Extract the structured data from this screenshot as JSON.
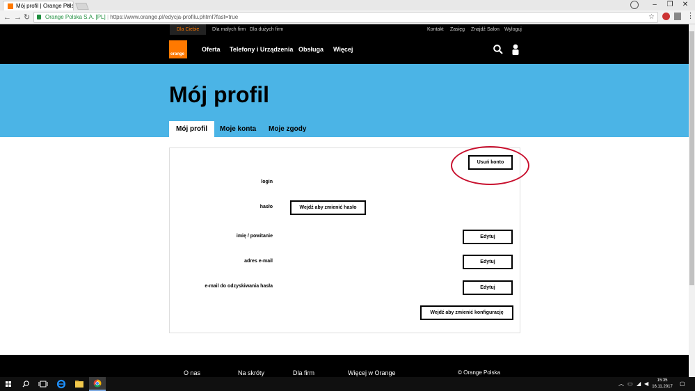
{
  "browser": {
    "tab_title": "Mój profil | Orange Polsk",
    "tab_close": "✕",
    "window_controls": [
      "–",
      "❐",
      "✕"
    ],
    "back": "←",
    "forward": "→",
    "reload": "↻",
    "site_identity": "Orange Polska S.A. [PL]",
    "separator": "|",
    "url": "https://www.orange.pl/edycja-profilu.phtml?fast=true",
    "bookmark_star": "☆",
    "menu": "⋮"
  },
  "topbar": {
    "segments": [
      "Dla Ciebie",
      "Dla małych firm",
      "Dla dużych firm"
    ],
    "utility": [
      "Kontakt",
      "Zasięg",
      "Znajdź Salon",
      "Wyloguj"
    ]
  },
  "nav": {
    "logo_text": "orange",
    "links": [
      "Oferta",
      "Telefony i Urządzenia",
      "Obsługa",
      "Więcej"
    ]
  },
  "hero": {
    "title": "Mój profil",
    "tabs": [
      "Mój profil",
      "Moje konta",
      "Moje zgody"
    ]
  },
  "profile": {
    "delete_account": "Usuń konto",
    "login_label": "login",
    "password_label": "hasło",
    "change_password": "Wejdź aby zmienić hasło",
    "name_label": "imię / powitanie",
    "email_label": "adres e-mail",
    "recovery_label": "e-mail do odzyskiwania hasła",
    "edit": "Edytuj",
    "change_config": "Wejdź aby zmienić konfigurację"
  },
  "footer": {
    "links": [
      "O nas",
      "Na skróty",
      "Dla firm",
      "Więcej w Orange"
    ],
    "copyright": "© Orange Polska"
  },
  "taskbar": {
    "time": "15:35",
    "date": "16.11.2017"
  },
  "colors": {
    "brand": "#ff7900",
    "hero": "#4bb4e6",
    "highlight_ring": "#c8102e"
  }
}
